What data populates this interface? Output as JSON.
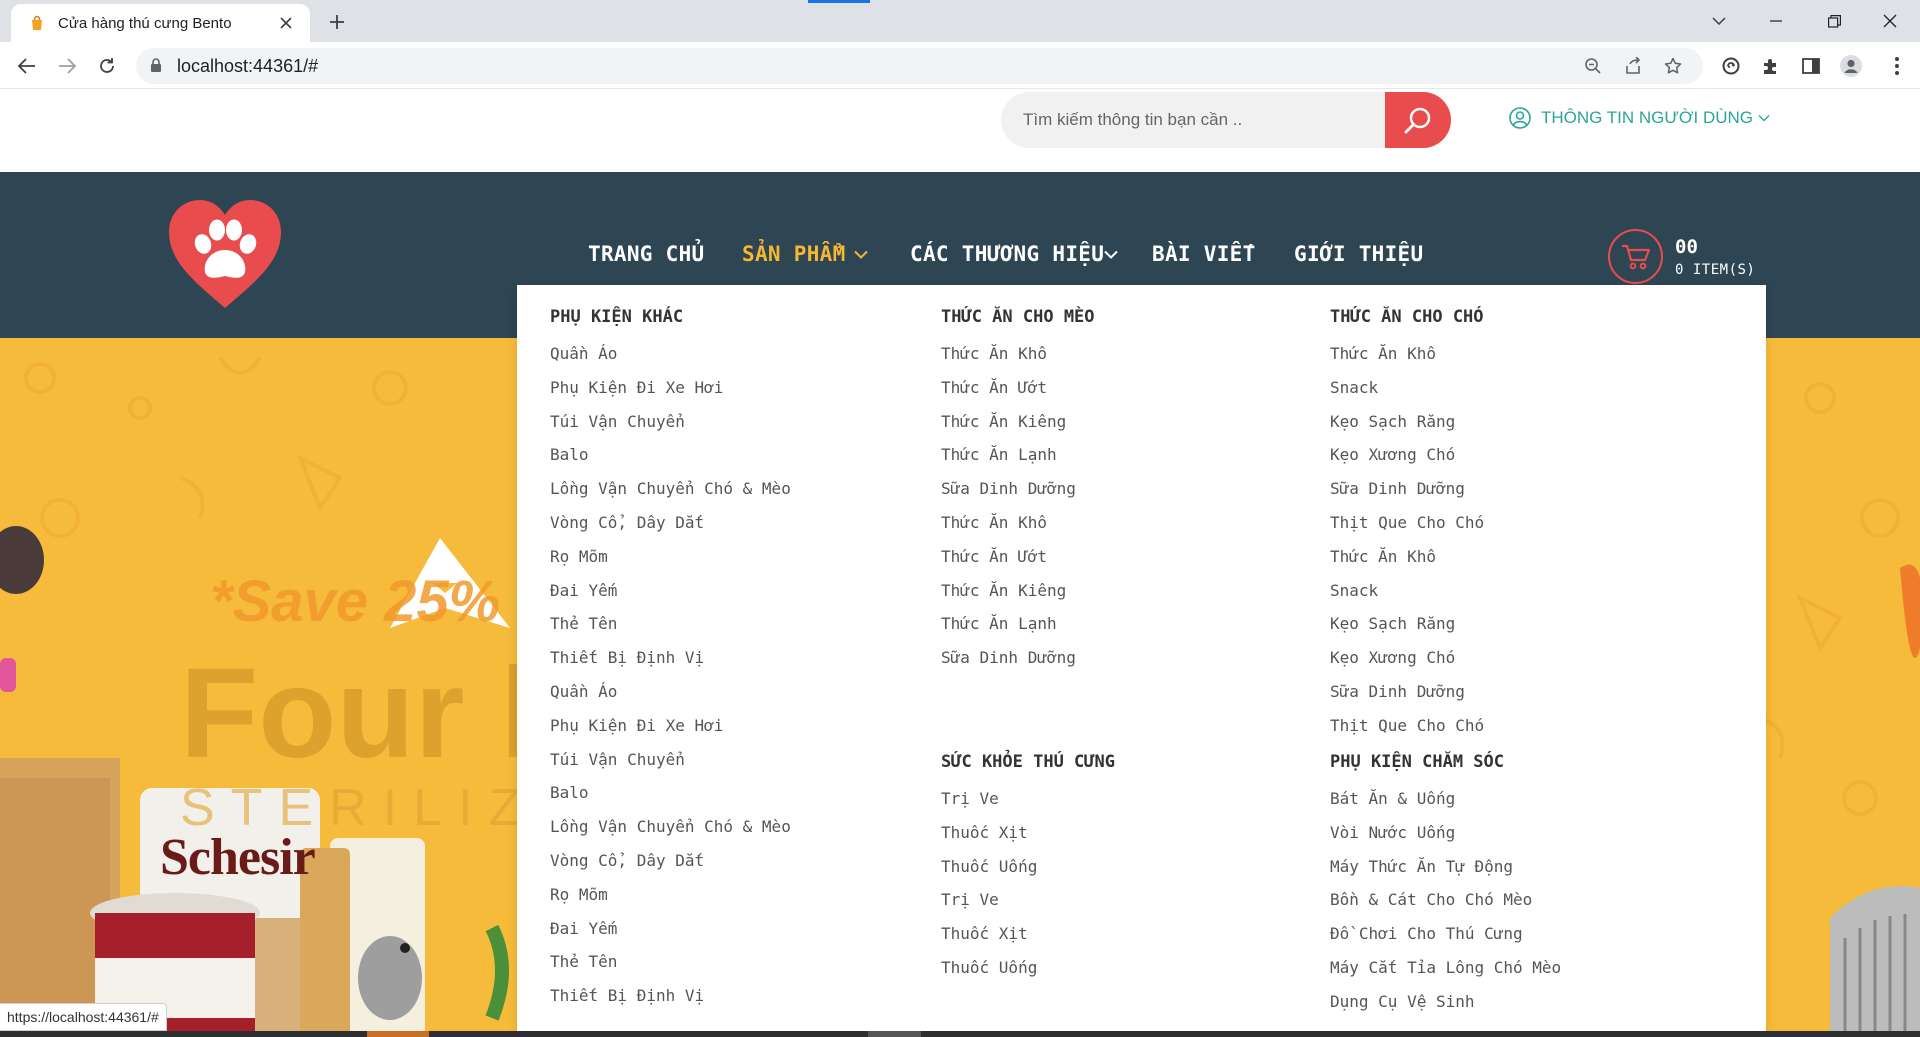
{
  "browser": {
    "tab_title": "Cửa hàng thú cưng Bento",
    "url": "localhost:44361/#",
    "status_url": "https://localhost:44361/#"
  },
  "site": {
    "search_placeholder": "Tìm kiếm thông tin bạn cần ..",
    "user_info_label": "THÔNG TIN NGƯỜI DÙNG",
    "nav": {
      "home": "TRANG CHỦ",
      "products": "SẢN PHẨM",
      "brands": "CÁC THƯƠNG HIỆU",
      "articles": "BÀI VIẾT",
      "about": "GIỚI THIỆU"
    },
    "cart": {
      "count": "00",
      "items_label": "0 ITEM(S)"
    },
    "accent_color": "#f7b731",
    "nav_background": "#2e4553",
    "search_button_color": "#e84c4c"
  },
  "hero": {
    "save_text": "*Save 25%",
    "brand_text": "Four l",
    "sterilized_text": "STERILIZE",
    "schesir_text": "Schesir"
  },
  "mega_menu": {
    "col1": {
      "heading": "PHỤ KIỆN KHÁC",
      "items": [
        "Quần Áo",
        "Phụ Kiện Đi Xe Hơi",
        "Túi Vận Chuyển",
        "Balo",
        "Lồng Vận Chuyển Chó & Mèo",
        "Vòng Cổ, Dây Dắt",
        "Rọ Mõm",
        "Đai Yếm",
        "Thẻ Tên",
        "Thiết Bị Định Vị",
        "Quần Áo",
        "Phụ Kiện Đi Xe Hơi",
        "Túi Vận Chuyển",
        "Balo",
        "Lồng Vận Chuyển Chó & Mèo",
        "Vòng Cổ, Dây Dắt",
        "Rọ Mõm",
        "Đai Yếm",
        "Thẻ Tên",
        "Thiết Bị Định Vị"
      ]
    },
    "col2": {
      "heading": "THỨC ĂN CHO MÈO",
      "items": [
        "Thức Ăn Khô",
        "Thức Ăn Ướt",
        "Thức Ăn Kiêng",
        "Thức Ăn Lạnh",
        "Sữa Dinh Dưỡng",
        "Thức Ăn Khô",
        "Thức Ăn Ướt",
        "Thức Ăn Kiêng",
        "Thức Ăn Lạnh",
        "Sữa Dinh Dưỡng"
      ]
    },
    "col2b": {
      "heading": "SỨC KHỎE THÚ CƯNG",
      "items": [
        "Trị Ve",
        "Thuốc Xịt",
        "Thuốc Uống",
        "Trị Ve",
        "Thuốc Xịt",
        "Thuốc Uống"
      ]
    },
    "col3": {
      "heading": "THỨC ĂN CHO CHÓ",
      "items": [
        "Thức Ăn Khô",
        "Snack",
        "Kẹo Sạch Răng",
        "Kẹo Xương Chó",
        "Sữa Dinh Dưỡng",
        "Thịt Que Cho Chó",
        "Thức Ăn Khô",
        "Snack",
        "Kẹo Sạch Răng",
        "Kẹo Xương Chó",
        "Sữa Dinh Dưỡng",
        "Thịt Que Cho Chó"
      ]
    },
    "col3b": {
      "heading": "PHỤ KIỆN CHĂM SÓC",
      "items": [
        "Bát Ăn & Uống",
        "Vòi Nước Uống",
        "Máy Thức Ăn Tự Động",
        "Bồn & Cát Cho Chó Mèo",
        "Đồ Chơi Cho Thú Cưng",
        "Máy Cắt Tỉa Lông Chó Mèo",
        "Dụng Cụ Vệ Sinh"
      ]
    }
  }
}
